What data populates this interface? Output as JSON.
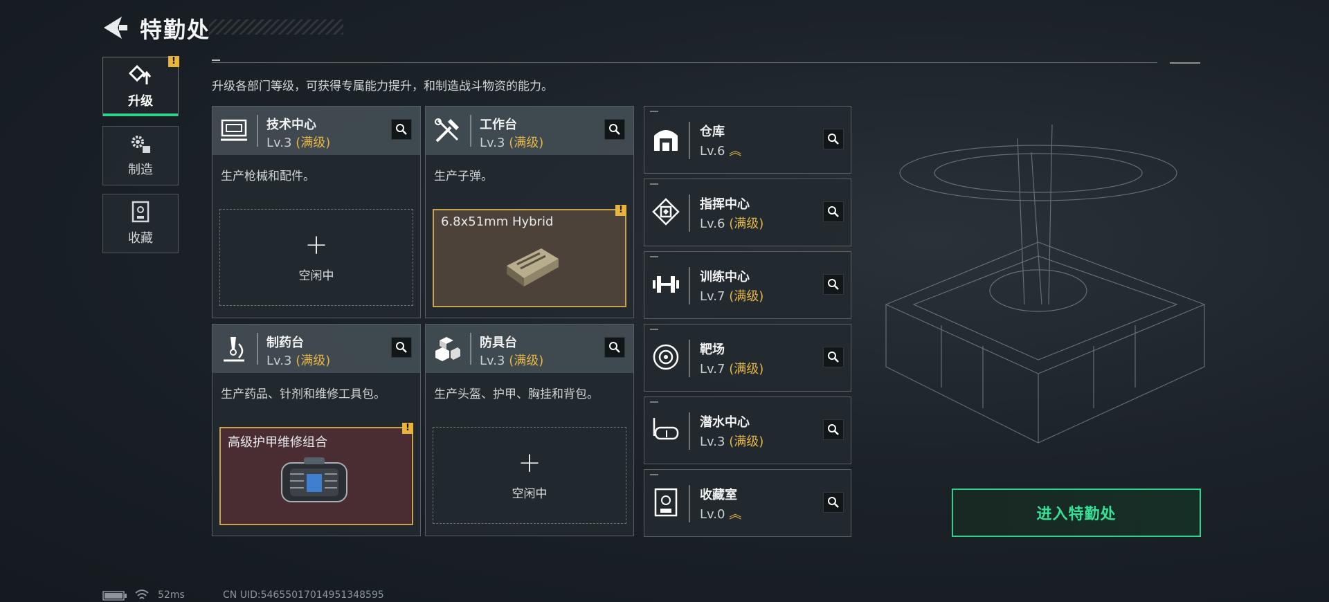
{
  "header": {
    "title": "特勤处"
  },
  "sidebar": {
    "tabs": [
      {
        "label": "升级",
        "active": true,
        "alert": "!"
      },
      {
        "label": "制造"
      },
      {
        "label": "收藏"
      }
    ]
  },
  "description": "升级各部门等级，可获得专属能力提升，和制造战斗物资的能力。",
  "main_cards": [
    {
      "name": "技术中心",
      "level": "Lv.3",
      "max": "(满级)",
      "desc": "生产枪械和配件。",
      "slot_text": "空闲中",
      "slot_plus": "+"
    },
    {
      "name": "工作台",
      "level": "Lv.3",
      "max": "(满级)",
      "desc": "生产子弹。",
      "slot_item": "6.8x51mm Hybrid",
      "slot_alert": "!"
    },
    {
      "name": "制药台",
      "level": "Lv.3",
      "max": "(满级)",
      "desc": "生产药品、针剂和维修工具包。",
      "slot_item": "高级护甲维修组合",
      "slot_alert": "!"
    },
    {
      "name": "防具台",
      "level": "Lv.3",
      "max": "(满级)",
      "desc": "生产头盔、护甲、胸挂和背包。",
      "slot_text": "空闲中",
      "slot_plus": "+"
    }
  ],
  "side_cards": [
    {
      "name": "仓库",
      "level": "Lv.6",
      "upgrade": "︽"
    },
    {
      "name": "指挥中心",
      "level": "Lv.6",
      "max": "(满级)"
    },
    {
      "name": "训练中心",
      "level": "Lv.7",
      "max": "(满级)"
    },
    {
      "name": "靶场",
      "level": "Lv.7",
      "max": "(满级)"
    },
    {
      "name": "潜水中心",
      "level": "Lv.3",
      "max": "(满级)"
    },
    {
      "name": "收藏室",
      "level": "Lv.0",
      "upgrade": "︽"
    }
  ],
  "enter_button": "进入特勤处",
  "status_bar": {
    "ping": "52ms",
    "uid": "CN UID:546550170149513485​95"
  },
  "colors": {
    "accent_green": "#2fd28d",
    "max_gold": "#e7b647",
    "alert_yellow": "#e9b43b"
  }
}
